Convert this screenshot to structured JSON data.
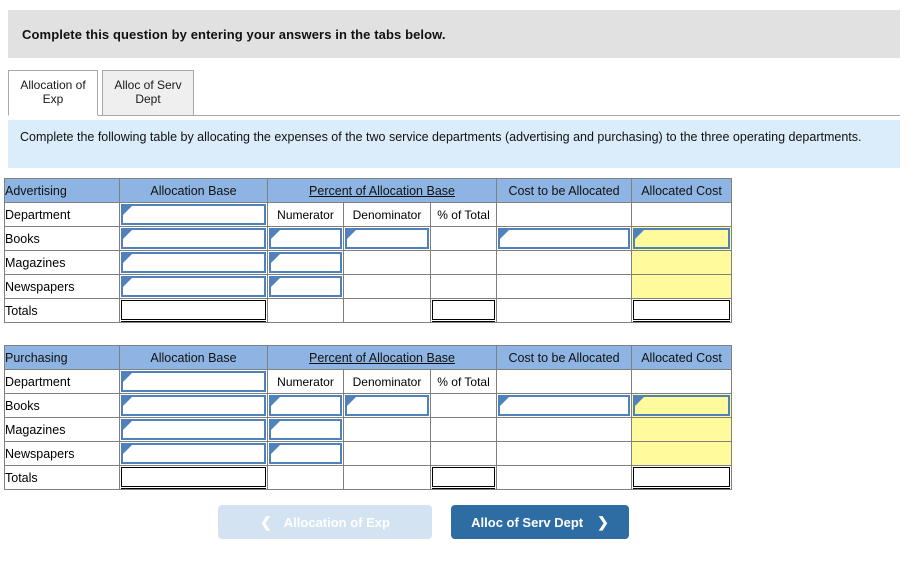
{
  "header": {
    "instruction": "Complete this question by entering your answers in the tabs below."
  },
  "tabs": [
    {
      "label_line1": "Allocation of",
      "label_line2": "Exp",
      "active": true
    },
    {
      "label_line1": "Alloc of Serv",
      "label_line2": "Dept",
      "active": false
    }
  ],
  "info_banner": {
    "text": "Complete the following table by allocating the expenses of the two service departments (advertising and purchasing) to the three operating departments."
  },
  "table_columns": {
    "allocation_base": "Allocation Base",
    "percent_group": "Percent of Allocation Base",
    "numerator": "Numerator",
    "denominator": "Denominator",
    "percent_of_total": "% of Total",
    "cost_to_be_allocated": "Cost to be Allocated",
    "allocated_cost": "Allocated Cost"
  },
  "tables": [
    {
      "name": "Advertising",
      "department_row_label": "Department",
      "rows": [
        {
          "label": "Books"
        },
        {
          "label": "Magazines"
        },
        {
          "label": "Newspapers"
        }
      ],
      "totals_label": "Totals"
    },
    {
      "name": "Purchasing",
      "department_row_label": "Department",
      "rows": [
        {
          "label": "Books"
        },
        {
          "label": "Magazines"
        },
        {
          "label": "Newspapers"
        }
      ],
      "totals_label": "Totals"
    }
  ],
  "nav": {
    "prev_label": "Allocation of Exp",
    "prev_icon": "chevron-left-icon",
    "next_label": "Alloc of Serv Dept",
    "next_icon": "chevron-right-icon"
  },
  "colors": {
    "banner_gray": "#e1e1e1",
    "banner_blue": "#dbedfa",
    "table_header_blue": "#8db4e2",
    "input_border_blue": "#4f81bd",
    "answer_yellow": "#fffb9d",
    "button_primary": "#2e6da4",
    "button_disabled": "#d3e3f2"
  }
}
